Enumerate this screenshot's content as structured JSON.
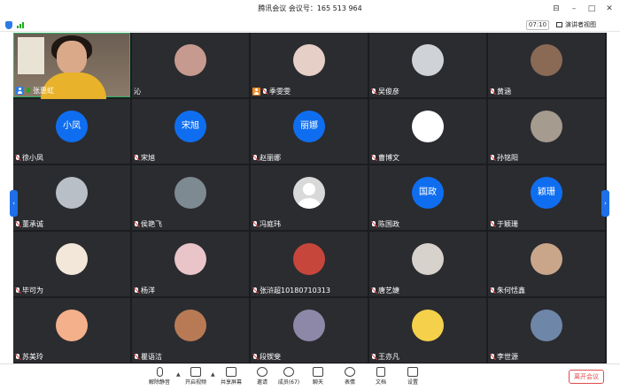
{
  "window": {
    "title": "腾讯会议  会议号：165 513 964",
    "timer": "07:10",
    "speaker_view": "演讲者视图"
  },
  "participants": [
    {
      "name": "张惠虹",
      "kind": "video",
      "mic": "on",
      "host": true
    },
    {
      "name": "沁",
      "kind": "photo",
      "color": "#c79a8f",
      "mic": "none"
    },
    {
      "name": "季雯雯",
      "kind": "photo",
      "color": "#e6cfc6",
      "mic": "muted",
      "host_badge": "orange"
    },
    {
      "name": "吴俊彦",
      "kind": "photo",
      "color": "#cfd3d8",
      "mic": "muted"
    },
    {
      "name": "黄涵",
      "kind": "photo",
      "color": "#8a6a55",
      "mic": "muted"
    },
    {
      "name": "徐小凤",
      "kind": "text",
      "label": "小凤",
      "mic": "muted"
    },
    {
      "name": "宋旭",
      "kind": "text",
      "label": "宋旭",
      "mic": "muted"
    },
    {
      "name": "赵丽娜",
      "kind": "text",
      "label": "丽娜",
      "mic": "muted"
    },
    {
      "name": "曹博文",
      "kind": "white",
      "mic": "muted"
    },
    {
      "name": "孙铭阳",
      "kind": "photo",
      "color": "#a59b8e",
      "mic": "muted"
    },
    {
      "name": "董承诚",
      "kind": "photo",
      "color": "#b8bfc6",
      "mic": "muted"
    },
    {
      "name": "侯艳飞",
      "kind": "photo",
      "color": "#7d8a92",
      "mic": "muted"
    },
    {
      "name": "冯庭玮",
      "kind": "gray",
      "mic": "muted"
    },
    {
      "name": "陈国政",
      "kind": "text",
      "label": "国政",
      "mic": "muted"
    },
    {
      "name": "于颖珊",
      "kind": "text",
      "label": "颖珊",
      "mic": "muted"
    },
    {
      "name": "毕可为",
      "kind": "photo",
      "color": "#f2e7d9",
      "mic": "muted"
    },
    {
      "name": "杨洋",
      "kind": "photo",
      "color": "#e9c4c8",
      "mic": "muted"
    },
    {
      "name": "张浒超10180710313",
      "kind": "photo",
      "color": "#c7463b",
      "mic": "muted"
    },
    {
      "name": "唐艺婕",
      "kind": "photo",
      "color": "#d8d2cd",
      "mic": "muted"
    },
    {
      "name": "朱何恬鑫",
      "kind": "photo",
      "color": "#c9a58a",
      "mic": "muted"
    },
    {
      "name": "苏美玲",
      "kind": "photo",
      "color": "#f3b08a",
      "mic": "muted"
    },
    {
      "name": "瞿语洁",
      "kind": "photo",
      "color": "#b87a55",
      "mic": "muted"
    },
    {
      "name": "段锲斐",
      "kind": "photo",
      "color": "#8e88a8",
      "mic": "muted"
    },
    {
      "name": "王亦凡",
      "kind": "photo",
      "color": "#f5d04a",
      "mic": "muted"
    },
    {
      "name": "李世源",
      "kind": "photo",
      "color": "#6e86a8",
      "mic": "muted"
    }
  ],
  "toolbar": {
    "unmute": "解除静音",
    "start_video": "开启视频",
    "share_screen": "共享屏幕",
    "invite": "邀请",
    "members": "成员(67)",
    "chat": "聊天",
    "reactions": "表情",
    "docs": "文档",
    "settings": "设置",
    "leave": "离开会议"
  }
}
